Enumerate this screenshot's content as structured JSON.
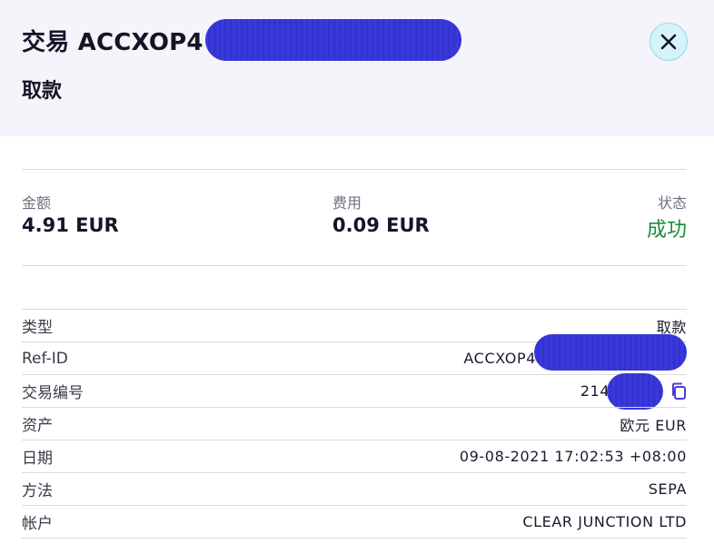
{
  "header": {
    "title": "交易 ACCXOP4",
    "subtitle": "取款"
  },
  "stats": {
    "amount_label": "金额",
    "amount_value": "4.91 EUR",
    "fee_label": "费用",
    "fee_value": "0.09 EUR",
    "status_label": "状态",
    "status_value": "成功"
  },
  "details": [
    {
      "label": "类型",
      "value": "取款"
    },
    {
      "label": "Ref-ID",
      "value": "ACCXOP4"
    },
    {
      "label": "交易编号",
      "value": "2144"
    },
    {
      "label": "资产",
      "value": "欧元 EUR"
    },
    {
      "label": "日期",
      "value": "09-08-2021 17:02:53 +08:00"
    },
    {
      "label": "方法",
      "value": "SEPA"
    },
    {
      "label": "帐户",
      "value": "CLEAR JUNCTION LTD"
    }
  ],
  "colors": {
    "header_bg": "#f4f4fa",
    "status_success": "#1e8a3a",
    "close_button_bg": "#d6f3fa",
    "copy_icon": "#4a3fd0",
    "redaction": "#3536d6"
  },
  "icons": {
    "close": "close-icon",
    "copy": "copy-icon"
  }
}
